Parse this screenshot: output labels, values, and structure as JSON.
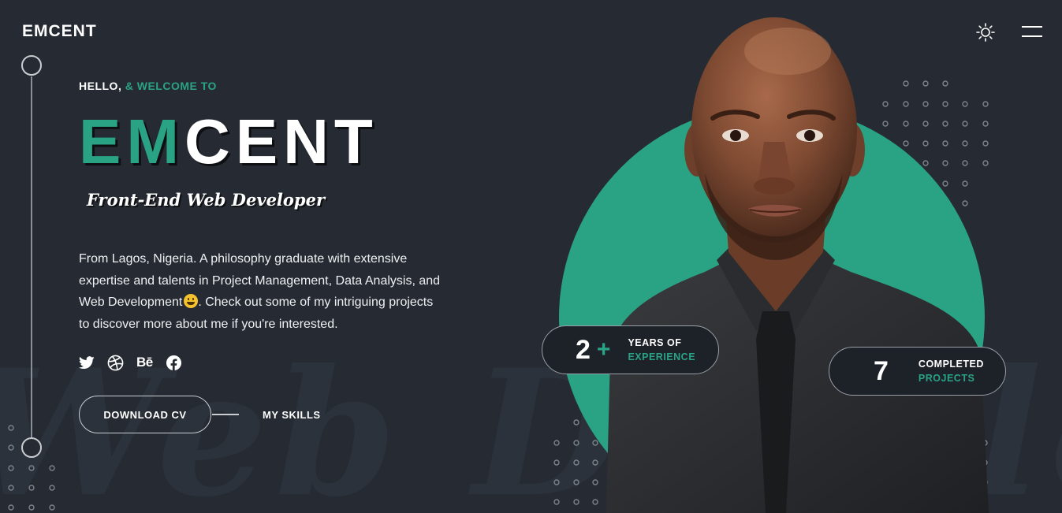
{
  "header": {
    "logo": "EMCENT",
    "theme_toggle_icon": "sun-icon",
    "menu_icon": "hamburger-menu-icon"
  },
  "hero": {
    "greeting_part1": "HELLO, ",
    "greeting_part2": "& WELCOME TO",
    "name_part1": "EM",
    "name_part2": "CENT",
    "role": "Front-End Web Developer",
    "bio_line1": "From Lagos, Nigeria. A philosophy graduate with extensive",
    "bio_line2": "expertise and talents in Project Management, Data Analysis, and",
    "bio_line3_a": "Web Development",
    "bio_emoji": "😀",
    "bio_line3_b": ". Check out some of my intriguing projects",
    "bio_line4": "to discover more about me if you're interested."
  },
  "socials": [
    {
      "name": "twitter",
      "icon": "twitter-icon"
    },
    {
      "name": "dribbble",
      "icon": "dribbble-icon"
    },
    {
      "name": "behance",
      "icon": "behance-icon",
      "text": "Bē"
    },
    {
      "name": "facebook",
      "icon": "facebook-icon"
    }
  ],
  "actions": {
    "download_cv": "DOWNLOAD CV",
    "my_skills": "MY SKILLS"
  },
  "stats": {
    "experience_number": "2",
    "experience_plus": "+",
    "experience_label1": "YEARS OF",
    "experience_label2": "EXPERIENCE",
    "projects_number": "7",
    "projects_label1": "COMPLETED",
    "projects_label2": "PROJECTS"
  },
  "colors": {
    "background": "#262b33",
    "accent": "#2aa384",
    "text": "#ffffff",
    "card_bg": "#1d2128"
  }
}
